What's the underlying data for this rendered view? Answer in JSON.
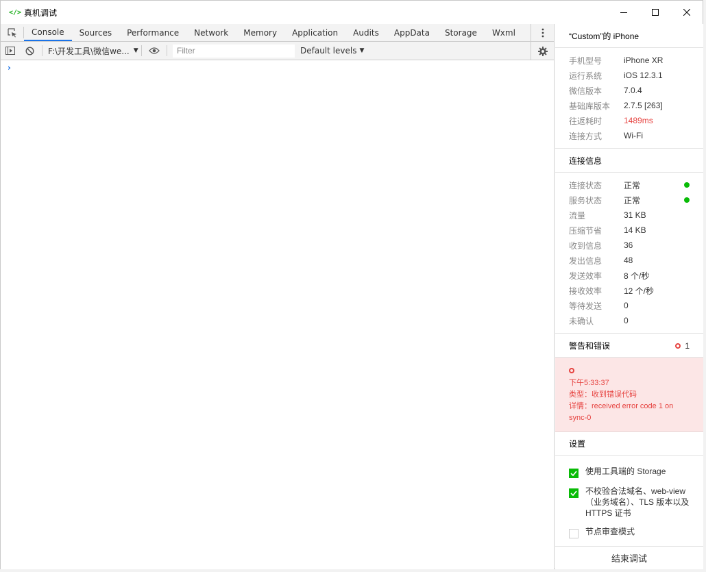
{
  "window": {
    "title": "真机调试",
    "app_icon": "</>"
  },
  "devtools": {
    "tabs": [
      "Console",
      "Sources",
      "Performance",
      "Network",
      "Memory",
      "Application",
      "Audits",
      "AppData",
      "Storage",
      "Wxml"
    ],
    "active_tab": "Console",
    "context": "F:\\开发工具\\微信we...",
    "filter_placeholder": "Filter",
    "levels": "Default levels",
    "prompt": "›"
  },
  "panel": {
    "device_header": "“Custom”的 iPhone",
    "device_info": [
      {
        "key": "手机型号",
        "value": "iPhone XR"
      },
      {
        "key": "运行系统",
        "value": "iOS 12.3.1"
      },
      {
        "key": "微信版本",
        "value": "7.0.4"
      },
      {
        "key": "基础库版本",
        "value": "2.7.5 [263]"
      },
      {
        "key": "往返耗时",
        "value": "1489ms"
      },
      {
        "key": "连接方式",
        "value": "Wi-Fi"
      }
    ],
    "connection_header": "连接信息",
    "connection_info": [
      {
        "key": "连接状态",
        "value": "正常"
      },
      {
        "key": "服务状态",
        "value": "正常"
      },
      {
        "key": "流量",
        "value": "31 KB"
      },
      {
        "key": "压缩节省",
        "value": "14 KB"
      },
      {
        "key": "收到信息",
        "value": "36"
      },
      {
        "key": "发出信息",
        "value": "48"
      },
      {
        "key": "发送效率",
        "value": "8 个/秒"
      },
      {
        "key": "接收效率",
        "value": "12 个/秒"
      },
      {
        "key": "等待发送",
        "value": "0"
      },
      {
        "key": "未确认",
        "value": "0"
      }
    ],
    "errors_header": "警告和错误",
    "errors_count": "1",
    "error": {
      "time": "下午5:33:37",
      "type": "类型：收到错误代码",
      "detail": "详情：received error code 1 on sync-0"
    },
    "settings_header": "设置",
    "settings": [
      {
        "label": "使用工具端的 Storage",
        "checked": true
      },
      {
        "label": "不校验合法域名、web-view（业务域名）、TLS 版本以及 HTTPS 证书",
        "checked": true
      },
      {
        "label": "节点审查模式",
        "checked": false
      }
    ],
    "end_button": "结束调试"
  },
  "colors": {
    "accent": "#1a73e8",
    "ok_green": "#09bb07",
    "error_red": "#e64340",
    "error_bg": "#fce6e6"
  }
}
